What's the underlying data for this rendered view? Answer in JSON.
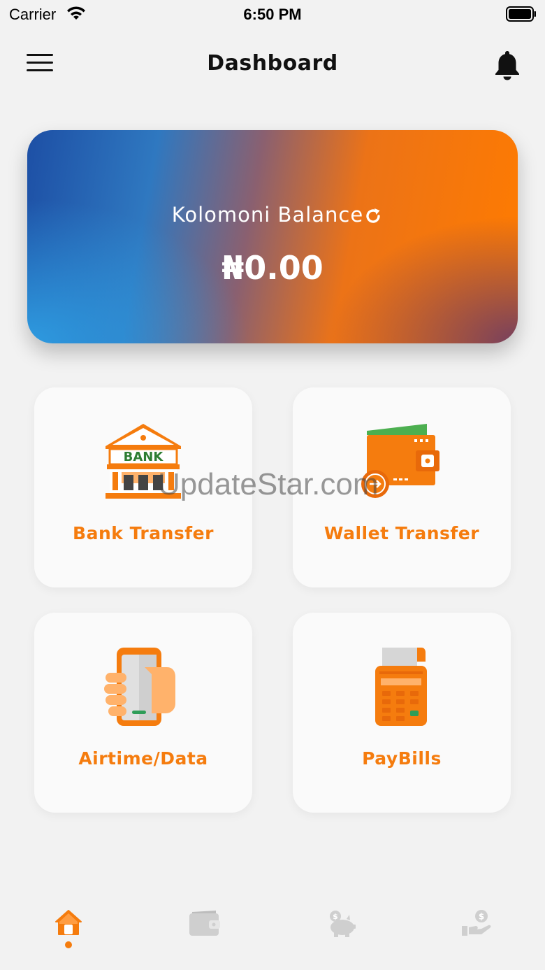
{
  "status_bar": {
    "carrier": "Carrier",
    "time": "6:50 PM"
  },
  "header": {
    "title": "Dashboard"
  },
  "balance": {
    "label": "Kolomoni Balance",
    "amount": "₦0.00"
  },
  "tiles": [
    {
      "label": "Bank Transfer",
      "icon": "bank-icon"
    },
    {
      "label": "Wallet Transfer",
      "icon": "wallet-icon"
    },
    {
      "label": "Airtime/Data",
      "icon": "phone-icon"
    },
    {
      "label": "PayBills",
      "icon": "pos-terminal-icon"
    }
  ],
  "bank_sign": "BANK",
  "watermark": "UpdateStar.com",
  "bottom_nav": [
    {
      "name": "home",
      "icon": "home-icon",
      "active": true
    },
    {
      "name": "wallet",
      "icon": "wallet-icon",
      "active": false
    },
    {
      "name": "savings",
      "icon": "piggy-bank-icon",
      "active": false
    },
    {
      "name": "loans",
      "icon": "hand-coin-icon",
      "active": false
    }
  ],
  "colors": {
    "accent": "#f57c0e",
    "green": "#4caf50",
    "inactive": "#cfcfcf",
    "background": "#f2f2f2"
  }
}
